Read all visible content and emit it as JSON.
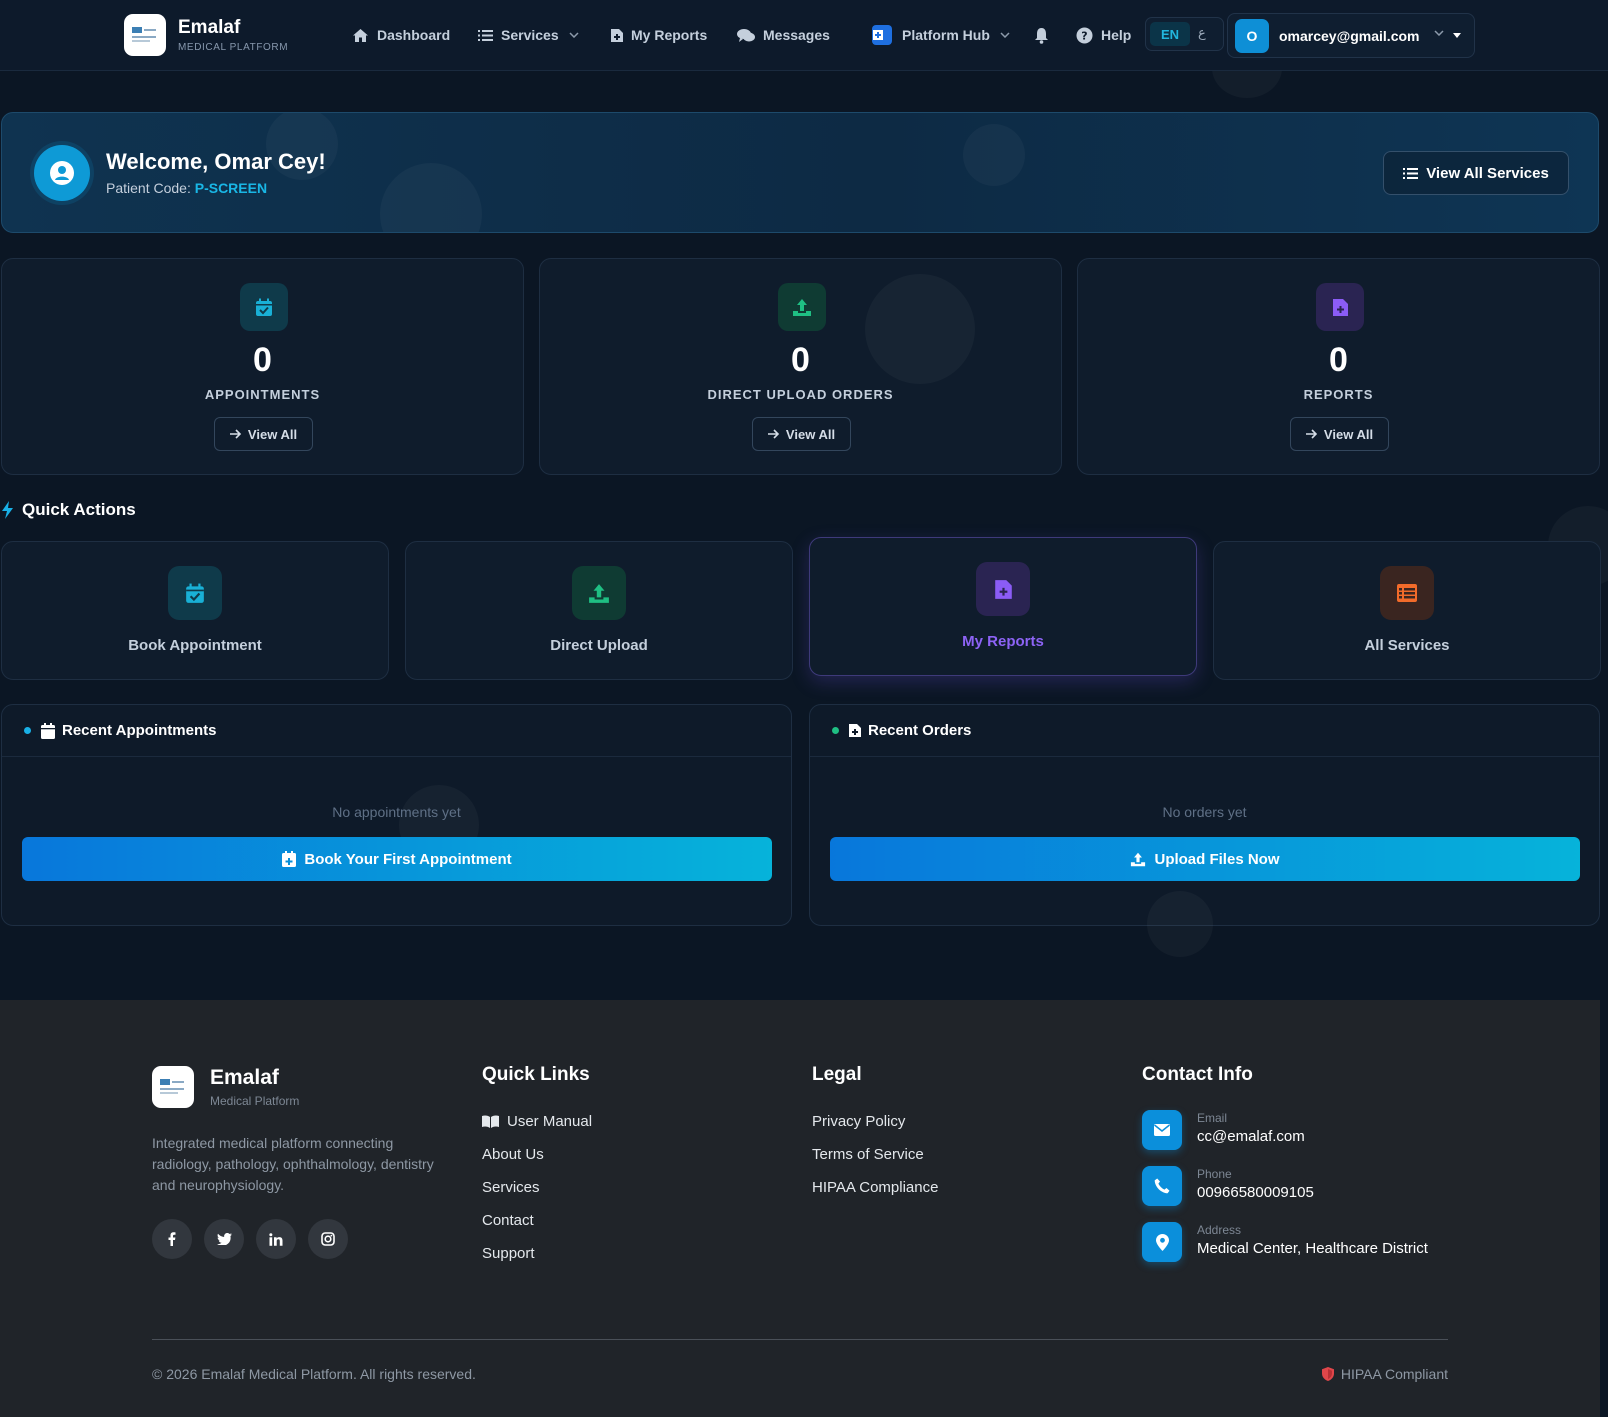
{
  "nav": {
    "brand_name": "Emalaf",
    "brand_sub": "MEDICAL PLATFORM",
    "items": [
      {
        "label": "Dashboard",
        "icon": "home-icon"
      },
      {
        "label": "Services",
        "icon": "list-icon"
      },
      {
        "label": "My Reports",
        "icon": "file-medical-icon"
      },
      {
        "label": "Messages",
        "icon": "comments-icon"
      }
    ],
    "platform_hub": "Platform Hub",
    "help": "Help",
    "lang_active": "EN",
    "lang_alt": "ع",
    "user_initial": "O",
    "user_email": "omarcey@gmail.com"
  },
  "welcome": {
    "title": "Welcome, Omar Cey!",
    "code_label": "Patient Code:",
    "code_value": "P-SCREEN",
    "view_all_services": "View All Services"
  },
  "stats": [
    {
      "value": "0",
      "label": "APPOINTMENTS",
      "button": "View All",
      "color": "#19b0d6"
    },
    {
      "value": "0",
      "label": "DIRECT UPLOAD ORDERS",
      "button": "View All",
      "color": "#1fbf83"
    },
    {
      "value": "0",
      "label": "REPORTS",
      "button": "View All",
      "color": "#8b5cf6"
    }
  ],
  "quick_actions": {
    "title": "Quick Actions",
    "items": [
      {
        "label": "Book Appointment",
        "color": "#19b0d6"
      },
      {
        "label": "Direct Upload",
        "color": "#1fbf83"
      },
      {
        "label": "My Reports",
        "color": "#8b5cf6"
      },
      {
        "label": "All Services",
        "color": "#f26b2a"
      }
    ]
  },
  "recent_appointments": {
    "title": "Recent Appointments",
    "empty": "No appointments yet",
    "button": "Book Your First Appointment"
  },
  "recent_orders": {
    "title": "Recent Orders",
    "empty": "No orders yet",
    "button": "Upload Files Now"
  },
  "footer": {
    "brand_name": "Emalaf",
    "brand_sub": "Medical Platform",
    "description": "Integrated medical platform connecting radiology, pathology, ophthalmology, dentistry and neurophysiology.",
    "quick_links_title": "Quick Links",
    "quick_links": [
      "User Manual",
      "About Us",
      "Services",
      "Contact",
      "Support"
    ],
    "legal_title": "Legal",
    "legal": [
      "Privacy Policy",
      "Terms of Service",
      "HIPAA Compliance"
    ],
    "contact_title": "Contact Info",
    "contact": [
      {
        "label": "Email",
        "value": "cc@emalaf.com"
      },
      {
        "label": "Phone",
        "value": "00966580009105"
      },
      {
        "label": "Address",
        "value": "Medical Center, Healthcare District"
      }
    ],
    "copyright": "© 2026 Emalaf Medical Platform. All rights reserved.",
    "hipaa": "HIPAA Compliant"
  }
}
